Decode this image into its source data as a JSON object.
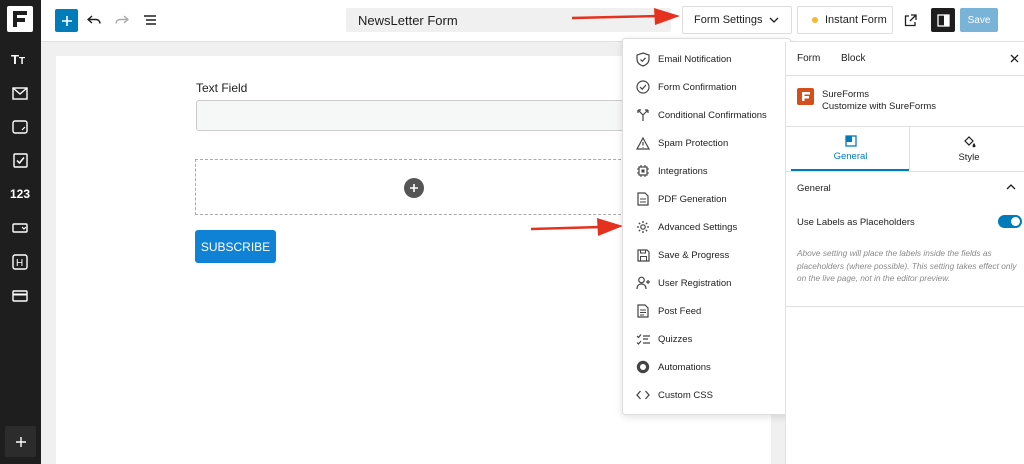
{
  "app": {
    "sidebar_icons": [
      "text-heading-icon",
      "email-icon",
      "textarea-icon",
      "checkbox-icon",
      "number-icon",
      "dropdown-icon",
      "hidden-field-icon",
      "payment-icon"
    ],
    "sidebar_number_label": "123",
    "sidebar_h_label": "H"
  },
  "toolbar": {
    "document_title": "NewsLetter Form",
    "form_settings_label": "Form Settings",
    "instant_form_label": "Instant Form",
    "save_label": "Save",
    "instant_dot_color": "#f5b82e",
    "accent_color": "#007cba"
  },
  "canvas": {
    "field_label": "Text Field",
    "button_label": "SUBSCRIBE",
    "button_color": "#0f82d5"
  },
  "dropdown": {
    "items": [
      {
        "label": "Email Notification",
        "icon": "shield-check-icon"
      },
      {
        "label": "Form Confirmation",
        "icon": "check-circle-icon"
      },
      {
        "label": "Conditional Confirmations",
        "icon": "split-icon"
      },
      {
        "label": "Spam Protection",
        "icon": "warning-icon"
      },
      {
        "label": "Integrations",
        "icon": "chip-icon"
      },
      {
        "label": "PDF Generation",
        "icon": "document-icon"
      },
      {
        "label": "Advanced Settings",
        "icon": "gear-icon"
      },
      {
        "label": "Save & Progress",
        "icon": "floppy-icon"
      },
      {
        "label": "User Registration",
        "icon": "user-plus-icon"
      },
      {
        "label": "Post Feed",
        "icon": "post-icon"
      },
      {
        "label": "Quizzes",
        "icon": "checklist-icon"
      },
      {
        "label": "Automations",
        "icon": "automation-icon"
      },
      {
        "label": "Custom CSS",
        "icon": "code-icon"
      }
    ]
  },
  "right_panel": {
    "tab_form": "Form",
    "tab_block": "Block",
    "brand_name": "SureForms",
    "brand_subtitle": "Customize with SureForms",
    "brand_color": "#d54f1c",
    "subtab_general": "General",
    "subtab_style": "Style",
    "section_heading": "General",
    "setting_label": "Use Labels as Placeholders",
    "setting_enabled": true,
    "help_text": "Above setting will place the labels inside the fields as placeholders (where possible). This setting takes effect only on the live page, not in the editor preview."
  }
}
